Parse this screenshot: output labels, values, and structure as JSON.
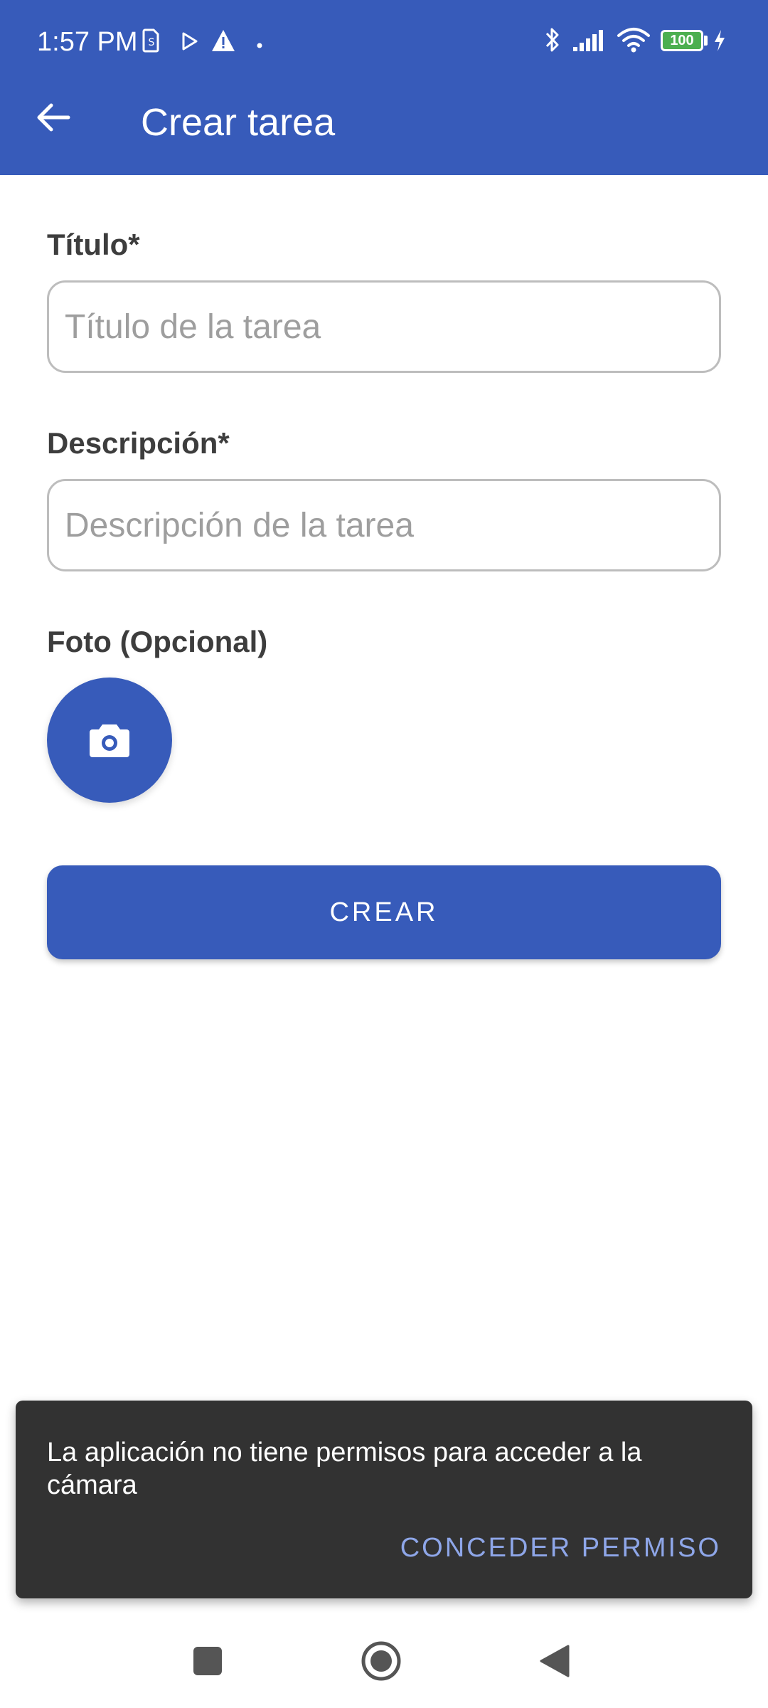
{
  "status_bar": {
    "time": "1:57 PM",
    "battery": "100",
    "icons": [
      "sim-icon",
      "play-icon",
      "warning-icon",
      "dot-icon",
      "bluetooth-icon",
      "signal-icon",
      "wifi-icon",
      "battery-icon",
      "charging-icon"
    ]
  },
  "app_bar": {
    "title": "Crear tarea",
    "back_icon": "arrow-back-icon",
    "color": "#375bba"
  },
  "form": {
    "title_label": "Título*",
    "title_placeholder": "Título de la tarea",
    "title_value": "",
    "description_label": "Descripción*",
    "description_placeholder": "Descripción de la tarea",
    "description_value": "",
    "photo_label": "Foto (Opcional)",
    "photo_icon": "camera-icon",
    "submit_label": "CREAR"
  },
  "snackbar": {
    "message": "La aplicación no tiene permisos para acceder a la cámara",
    "action": "CONCEDER PERMISO",
    "action_color": "#8ea6e8"
  },
  "nav_bar": {
    "icons": [
      "recents-icon",
      "home-icon",
      "back-icon"
    ]
  }
}
